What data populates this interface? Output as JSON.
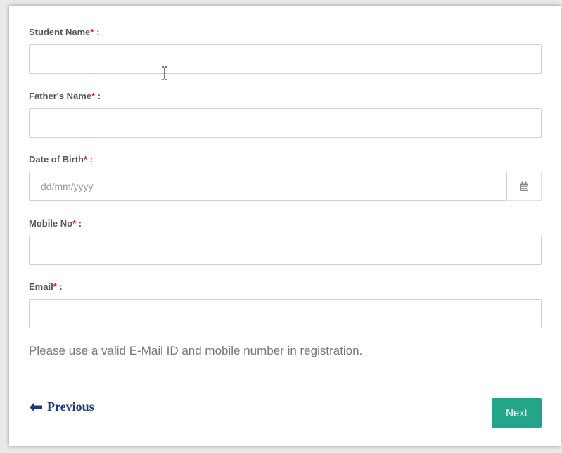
{
  "form": {
    "fields": [
      {
        "label": "Student Name",
        "required_mark": "*",
        "suffix": " :",
        "value": "",
        "placeholder": ""
      },
      {
        "label": "Father's Name",
        "required_mark": "*",
        "suffix": " :",
        "value": "",
        "placeholder": ""
      },
      {
        "label": "Date of Birth",
        "required_mark": "*",
        "suffix": " :",
        "value": "",
        "placeholder": "dd/mm/yyyy"
      },
      {
        "label": "Mobile No",
        "required_mark": "*",
        "suffix": " :",
        "value": "",
        "placeholder": ""
      },
      {
        "label": "Email",
        "required_mark": "*",
        "suffix": " :",
        "value": "",
        "placeholder": ""
      }
    ],
    "note": "Please use a valid E-Mail ID and mobile number in registration.",
    "previous_label": "Previous",
    "next_label": "Next"
  },
  "colors": {
    "required": "#d9232d",
    "next_button": "#22a589",
    "previous_link": "#1f3a7a"
  },
  "icons": {
    "calendar": "calendar-icon",
    "previous_arrow": "arrow-left-icon",
    "text_cursor": "text-cursor-icon"
  }
}
